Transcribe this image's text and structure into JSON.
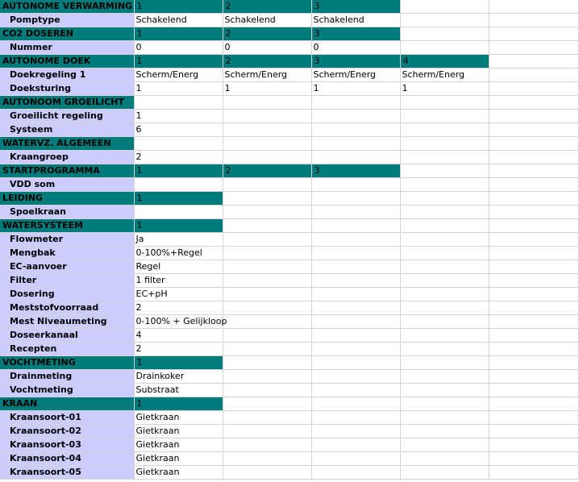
{
  "colors": {
    "section_header": "#007b7b",
    "row_label": "#ccccff",
    "grid_line": "#d4d4d4"
  },
  "rows": [
    {
      "type": "head",
      "cells": [
        "AUTONOME VERWARMING",
        "1",
        "2",
        "3"
      ]
    },
    {
      "type": "data",
      "cells": [
        "Pomptype",
        "Schakelend",
        "Schakelend",
        "Schakelend"
      ]
    },
    {
      "type": "head",
      "cells": [
        "CO2 DOSEREN",
        "1",
        "2",
        "3"
      ]
    },
    {
      "type": "data",
      "cells": [
        "Nummer",
        "0",
        "0",
        "0"
      ]
    },
    {
      "type": "head",
      "cells": [
        "AUTONOME DOEK",
        "1",
        "2",
        "3",
        "4"
      ]
    },
    {
      "type": "data",
      "cells": [
        "Doekregeling 1",
        "Scherm/Energ",
        "Scherm/Energ",
        "Scherm/Energ",
        "Scherm/Energ"
      ]
    },
    {
      "type": "data",
      "cells": [
        "Doeksturing",
        "1",
        "1",
        "1",
        "1"
      ]
    },
    {
      "type": "head",
      "cells": [
        "AUTONOOM GROEILICHT"
      ]
    },
    {
      "type": "data",
      "cells": [
        "Groeilicht regeling",
        "1"
      ]
    },
    {
      "type": "data",
      "cells": [
        "Systeem",
        "6"
      ]
    },
    {
      "type": "head",
      "cells": [
        "WATERVZ. ALGEMEEN"
      ]
    },
    {
      "type": "data",
      "cells": [
        "Kraangroep",
        "2"
      ]
    },
    {
      "type": "head",
      "cells": [
        "STARTPROGRAMMA",
        "1",
        "2",
        "3"
      ]
    },
    {
      "type": "data",
      "cells": [
        "VDD som"
      ]
    },
    {
      "type": "head",
      "cells": [
        "LEIDING",
        "1"
      ]
    },
    {
      "type": "data",
      "cells": [
        "Spoelkraan"
      ]
    },
    {
      "type": "head",
      "cells": [
        "WATERSYSTEEM",
        "1"
      ]
    },
    {
      "type": "data",
      "cells": [
        "Flowmeter",
        "Ja"
      ]
    },
    {
      "type": "data",
      "cells": [
        "Mengbak",
        "0-100%+Regel"
      ]
    },
    {
      "type": "data",
      "cells": [
        "EC-aanvoer",
        "Regel"
      ]
    },
    {
      "type": "data",
      "cells": [
        "Filter",
        "1 filter"
      ]
    },
    {
      "type": "data",
      "cells": [
        "Dosering",
        "EC+pH"
      ]
    },
    {
      "type": "data",
      "cells": [
        "Meststofvoorraad",
        "2"
      ]
    },
    {
      "type": "data",
      "cells": [
        "Mest Niveaumeting",
        "0-100% + Gelijkloop"
      ]
    },
    {
      "type": "data",
      "cells": [
        "Doseerkanaal",
        "4"
      ]
    },
    {
      "type": "data",
      "cells": [
        "Recepten",
        "2"
      ]
    },
    {
      "type": "head",
      "cells": [
        "VOCHTMETING",
        "1"
      ]
    },
    {
      "type": "data",
      "cells": [
        "Drainmeting",
        "Drainkoker"
      ]
    },
    {
      "type": "data",
      "cells": [
        "Vochtmeting",
        "Substraat"
      ]
    },
    {
      "type": "head",
      "cells": [
        "KRAAN",
        "1"
      ]
    },
    {
      "type": "data",
      "cells": [
        "Kraansoort-01",
        "Gietkraan"
      ]
    },
    {
      "type": "data",
      "cells": [
        "Kraansoort-02",
        "Gietkraan"
      ]
    },
    {
      "type": "data",
      "cells": [
        "Kraansoort-03",
        "Gietkraan"
      ]
    },
    {
      "type": "data",
      "cells": [
        "Kraansoort-04",
        "Gietkraan"
      ]
    },
    {
      "type": "data",
      "cells": [
        "Kraansoort-05",
        "Gietkraan"
      ]
    }
  ]
}
